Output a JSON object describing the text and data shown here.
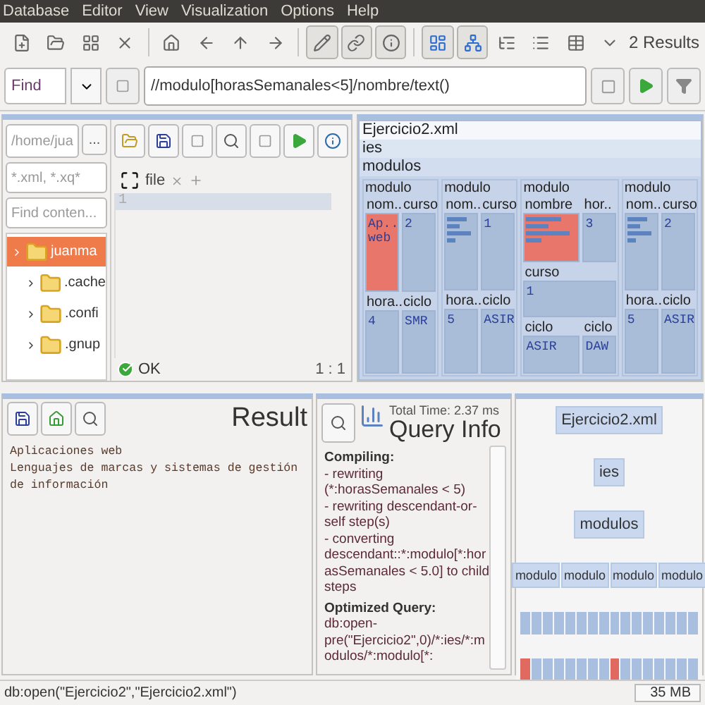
{
  "menu": [
    "Database",
    "Editor",
    "View",
    "Visualization",
    "Options",
    "Help"
  ],
  "toolbar": {
    "groups": [
      [
        {
          "pressed": false
        },
        {
          "pressed": false
        },
        {
          "pressed": false
        },
        {
          "pressed": false
        }
      ],
      [
        {
          "pressed": false
        },
        {
          "pressed": false
        },
        {
          "pressed": false
        },
        {
          "pressed": false
        }
      ],
      [
        {
          "pressed": true
        },
        {
          "pressed": true
        },
        {
          "pressed": true
        }
      ],
      [
        {
          "pressed": true
        },
        {
          "pressed": true
        },
        {
          "pressed": false
        },
        {
          "pressed": false
        },
        {
          "pressed": false
        },
        {
          "pressed": false
        }
      ]
    ],
    "results": "2 Results"
  },
  "query_bar": {
    "mode": "Find",
    "value": "//modulo[horasSemanales<5]/nombre/text()"
  },
  "file_browser": {
    "path": "/home/jua",
    "browse": "...",
    "filter": "*.xml, *.xq*",
    "search_placeholder": "Find conten...",
    "items": [
      {
        "name": "juanma",
        "selected": true,
        "children": [
          {
            "name": ".cache",
            "selected": false
          },
          {
            "name": ".confi",
            "selected": false
          },
          {
            "name": ".gnup",
            "selected": false
          }
        ]
      }
    ]
  },
  "editor": {
    "tab": "file",
    "lines": [
      "1"
    ],
    "status": "OK",
    "position": "1 : 1"
  },
  "map": {
    "document": "Ejercicio2.xml",
    "root": "ies",
    "parent": "modulos",
    "modulos": [
      {
        "label": "modulo",
        "fields": [
          {
            "label": "nom..",
            "value": "Ap.. web",
            "highlighted": true
          },
          {
            "label": "curso",
            "value": "2",
            "highlighted": false
          },
          {
            "label": "hora..",
            "value": "4",
            "highlighted": false
          },
          {
            "label": "ciclo",
            "value": "SMR",
            "highlighted": false
          }
        ]
      },
      {
        "label": "modulo",
        "fields": [
          {
            "label": "nom..",
            "highlighted": false
          },
          {
            "label": "curso",
            "value": "1",
            "highlighted": false
          },
          {
            "label": "hora..",
            "value": "5",
            "highlighted": false
          },
          {
            "label": "ciclo",
            "value": "ASIR",
            "highlighted": false
          }
        ]
      },
      {
        "label": "modulo",
        "fields": [
          {
            "label": "nombre",
            "highlighted": true
          },
          {
            "label": "hor..",
            "value": "3",
            "highlighted": false
          },
          {
            "label": "curso",
            "value": "1",
            "highlighted": false
          },
          {
            "label": "ciclo",
            "value": "ASIR",
            "highlighted": false
          },
          {
            "label": "ciclo",
            "value": "DAW",
            "highlighted": false
          }
        ]
      },
      {
        "label": "modulo",
        "fields": [
          {
            "label": "nom..",
            "highlighted": false
          },
          {
            "label": "curso",
            "value": "2",
            "highlighted": false
          },
          {
            "label": "hora..",
            "value": "5",
            "highlighted": false
          },
          {
            "label": "ciclo",
            "value": "ASIR",
            "highlighted": false
          }
        ]
      }
    ]
  },
  "result": {
    "title": "Result",
    "lines": [
      "Aplicaciones web",
      "Lenguajes de marcas y sistemas de gestión de información"
    ]
  },
  "query_info": {
    "total_time": "Total Time: 2.37 ms",
    "title": "Query Info",
    "sections": [
      {
        "heading": "Compiling:",
        "lines": [
          "- rewriting (*:horasSemanales < 5)",
          "- rewriting descendant-or-self step(s)",
          "- converting descendant::*:modulo[*:horasSemanales < 5.0] to child steps"
        ]
      },
      {
        "heading": "Optimized Query:",
        "lines": [
          "db:open-pre(\"Ejercicio2\",0)/*:ies/*:modulos/*:modulo[*:"
        ]
      }
    ]
  },
  "tree": {
    "document": "Ejercicio2.xml",
    "root": "ies",
    "parent": "modulos",
    "modulos": [
      "modulo",
      "modulo",
      "modulo",
      "modulo"
    ],
    "leaves": [
      {
        "highlighted": true
      },
      {
        "highlighted": false
      },
      {
        "highlighted": false
      },
      {
        "highlighted": false
      },
      {
        "highlighted": false
      },
      {
        "highlighted": false
      },
      {
        "highlighted": false
      },
      {
        "highlighted": false
      },
      {
        "highlighted": true
      },
      {
        "highlighted": false
      },
      {
        "highlighted": false
      },
      {
        "highlighted": false
      },
      {
        "highlighted": false
      },
      {
        "highlighted": false
      },
      {
        "highlighted": false
      },
      {
        "highlighted": false
      }
    ]
  },
  "status_bar": {
    "command": "db:open(\"Ejercicio2\",\"Ejercicio2.xml\")",
    "memory": "35 MB"
  }
}
